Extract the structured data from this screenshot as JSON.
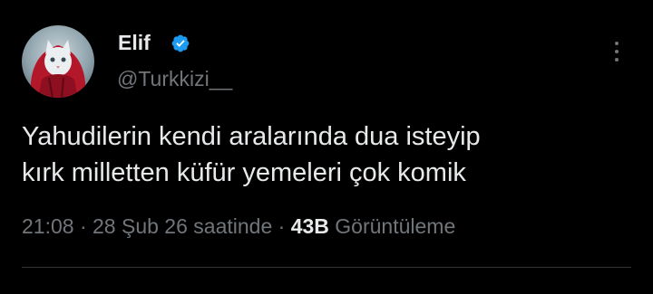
{
  "tweet": {
    "author": {
      "display_name": "Elif",
      "handle": "@Turkkizi__",
      "verified": true,
      "verified_color": "#1d9bf0",
      "avatar_icon": "cat-avatar"
    },
    "more_icon": "more-options-icon",
    "text_lines": [
      "Yahudilerin kendi aralarında dua isteyip",
      "kırk milletten küfür yemeleri çok komik"
    ],
    "time": "21:08",
    "date": "28 Şub 26 saatinde",
    "views_count": "43B",
    "views_label": "Görüntüleme",
    "separator": "·"
  }
}
